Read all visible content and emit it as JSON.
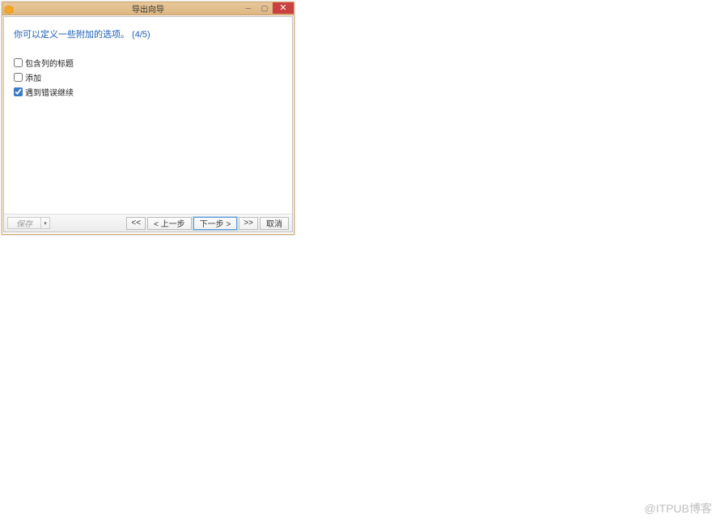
{
  "window": {
    "title": "导出向导"
  },
  "description": "你可以定义一些附加的选项。 (4/5)",
  "options": [
    {
      "label": "包含列的标题",
      "checked": false
    },
    {
      "label": "添加",
      "checked": false
    },
    {
      "label": "遇到错误继续",
      "checked": true
    }
  ],
  "buttons": {
    "save": "保存",
    "first": "<<",
    "prev": "< 上一步",
    "next": "下一步 >",
    "last": ">>",
    "cancel": "取消"
  },
  "watermark": "@ITPUB博客"
}
